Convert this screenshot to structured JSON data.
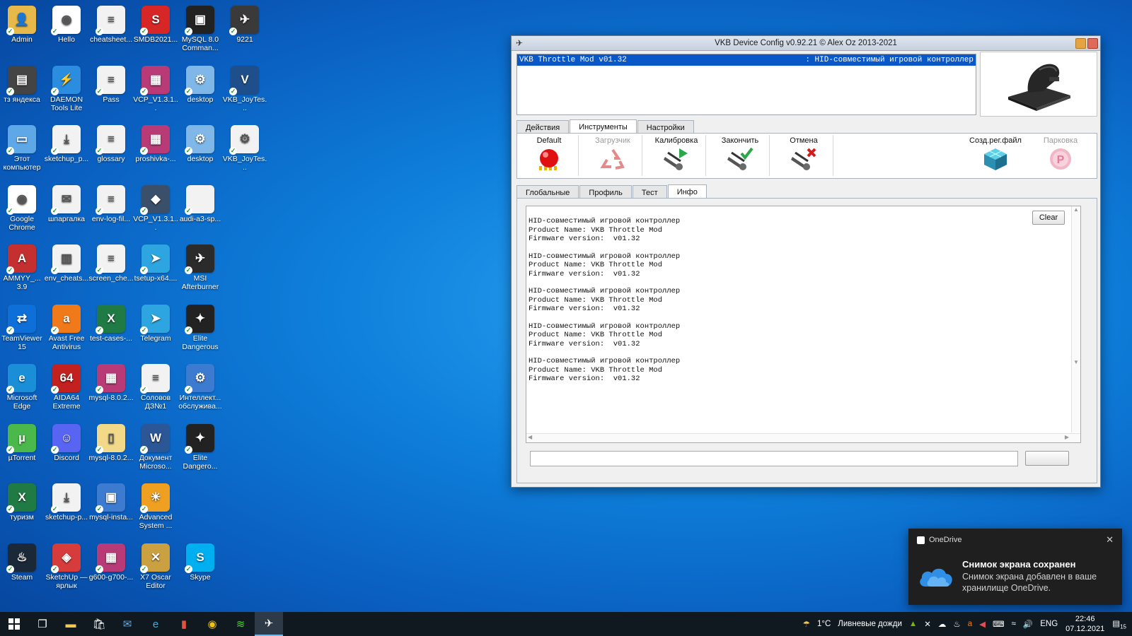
{
  "desktop": {
    "icons": [
      {
        "label": "Admin",
        "color": "#e7b84a",
        "glyph": "👤",
        "col": 0,
        "row": 0
      },
      {
        "label": "Hello",
        "color": "#ffffff",
        "glyph": "◉",
        "col": 1,
        "row": 0
      },
      {
        "label": "cheatsheet...",
        "color": "#f2f2f2",
        "glyph": "≡",
        "col": 2,
        "row": 0
      },
      {
        "label": "SMDB2021...",
        "color": "#d72626",
        "glyph": "S",
        "col": 3,
        "row": 0
      },
      {
        "label": "MySQL 8.0 Comman...",
        "color": "#222",
        "glyph": "▣",
        "col": 4,
        "row": 0
      },
      {
        "label": "9221",
        "color": "#3a3a3a",
        "glyph": "✈",
        "col": 5,
        "row": 0
      },
      {
        "label": "тз яндекса",
        "color": "#444",
        "glyph": "▤",
        "col": 0,
        "row": 1
      },
      {
        "label": "DAEMON Tools Lite",
        "color": "#2a8de0",
        "glyph": "⚡",
        "col": 1,
        "row": 1
      },
      {
        "label": "Pass",
        "color": "#f2f2f2",
        "glyph": "≡",
        "col": 2,
        "row": 1
      },
      {
        "label": "VCP_V1.3.1...",
        "color": "#b83b77",
        "glyph": "▦",
        "col": 3,
        "row": 1
      },
      {
        "label": "desktop",
        "color": "#7fb8e8",
        "glyph": "⚙",
        "col": 4,
        "row": 1
      },
      {
        "label": "VKB_JoyTes...",
        "color": "#1f4f8a",
        "glyph": "V",
        "col": 5,
        "row": 1
      },
      {
        "label": "Этот компьютер",
        "color": "#5fa8e8",
        "glyph": "▭",
        "col": 0,
        "row": 2
      },
      {
        "label": "sketchup_p...",
        "color": "#f2f2f2",
        "glyph": "⤓",
        "col": 1,
        "row": 2
      },
      {
        "label": "glossary",
        "color": "#f2f2f2",
        "glyph": "≡",
        "col": 2,
        "row": 2
      },
      {
        "label": "proshivka-...",
        "color": "#b83b77",
        "glyph": "▦",
        "col": 3,
        "row": 2
      },
      {
        "label": "desktop",
        "color": "#7fb8e8",
        "glyph": "⚙",
        "col": 4,
        "row": 2
      },
      {
        "label": "VKB_JoyTes...",
        "color": "#f2f2f2",
        "glyph": "⚙",
        "col": 5,
        "row": 2
      },
      {
        "label": "Google Chrome",
        "color": "#ffffff",
        "glyph": "◉",
        "col": 0,
        "row": 3
      },
      {
        "label": "шпаргалка",
        "color": "#f2f2f2",
        "glyph": "✉",
        "col": 1,
        "row": 3
      },
      {
        "label": "env-log-fil...",
        "color": "#f2f2f2",
        "glyph": "≡",
        "col": 2,
        "row": 3
      },
      {
        "label": "VCP_V1.3.1...",
        "color": "#3a4f6a",
        "glyph": "◆",
        "col": 3,
        "row": 3
      },
      {
        "label": "audi-a3-sp...",
        "color": "#f2f2f2",
        "glyph": "",
        "col": 4,
        "row": 3
      },
      {
        "label": "AMMYY_... 3.9",
        "color": "#c43030",
        "glyph": "A",
        "col": 0,
        "row": 4
      },
      {
        "label": "env_cheats...",
        "color": "#f2f2f2",
        "glyph": "▥",
        "col": 1,
        "row": 4
      },
      {
        "label": "screen_che...",
        "color": "#f2f2f2",
        "glyph": "≡",
        "col": 2,
        "row": 4
      },
      {
        "label": "tsetup-x64....",
        "color": "#2ca5e0",
        "glyph": "➤",
        "col": 3,
        "row": 4
      },
      {
        "label": "MSI Afterburner",
        "color": "#2b2b2b",
        "glyph": "✈",
        "col": 4,
        "row": 4
      },
      {
        "label": "TeamViewer 15",
        "color": "#0e6fd8",
        "glyph": "⇄",
        "col": 0,
        "row": 5
      },
      {
        "label": "Avast Free Antivirus",
        "color": "#f07a1a",
        "glyph": "a",
        "col": 1,
        "row": 5
      },
      {
        "label": "test-cases-...",
        "color": "#1f7a43",
        "glyph": "X",
        "col": 2,
        "row": 5
      },
      {
        "label": "Telegram",
        "color": "#2ca5e0",
        "glyph": "➤",
        "col": 3,
        "row": 5
      },
      {
        "label": "Elite Dangerous",
        "color": "#222",
        "glyph": "✦",
        "col": 4,
        "row": 5
      },
      {
        "label": "Microsoft Edge",
        "color": "#1a8fd8",
        "glyph": "e",
        "col": 0,
        "row": 6
      },
      {
        "label": "AIDA64 Extreme",
        "color": "#c32020",
        "glyph": "64",
        "col": 1,
        "row": 6
      },
      {
        "label": "mysql-8.0.2...",
        "color": "#b83b77",
        "glyph": "▦",
        "col": 2,
        "row": 6
      },
      {
        "label": "Соловов ДЗ№1",
        "color": "#f2f2f2",
        "glyph": "≡",
        "col": 3,
        "row": 6
      },
      {
        "label": "Интеллект... обслужива...",
        "color": "#3c7bd0",
        "glyph": "⚙",
        "col": 4,
        "row": 6
      },
      {
        "label": "µTorrent",
        "color": "#4ab84a",
        "glyph": "µ",
        "col": 0,
        "row": 7
      },
      {
        "label": "Discord",
        "color": "#5865f2",
        "glyph": "☺",
        "col": 1,
        "row": 7
      },
      {
        "label": "mysql-8.0.2...",
        "color": "#f2d98a",
        "glyph": "▯",
        "col": 2,
        "row": 7
      },
      {
        "label": "Документ Microso...",
        "color": "#2b5797",
        "glyph": "W",
        "col": 3,
        "row": 7
      },
      {
        "label": "Elite Dangero...",
        "color": "#222",
        "glyph": "✦",
        "col": 4,
        "row": 7
      },
      {
        "label": "туризм",
        "color": "#1f7a43",
        "glyph": "X",
        "col": 0,
        "row": 8
      },
      {
        "label": "sketchup-p...",
        "color": "#f2f2f2",
        "glyph": "⤓",
        "col": 1,
        "row": 8
      },
      {
        "label": "mysql-insta...",
        "color": "#3c7bd0",
        "glyph": "▣",
        "col": 2,
        "row": 8
      },
      {
        "label": "Advanced System ...",
        "color": "#f0a020",
        "glyph": "☀",
        "col": 3,
        "row": 8
      },
      {
        "label": "Steam",
        "color": "#1b2838",
        "glyph": "♨",
        "col": 0,
        "row": 9
      },
      {
        "label": "SketchUp — ярлык",
        "color": "#d63c3c",
        "glyph": "◈",
        "col": 1,
        "row": 9
      },
      {
        "label": "g600-g700-...",
        "color": "#b83b77",
        "glyph": "▦",
        "col": 2,
        "row": 9
      },
      {
        "label": "X7 Oscar Editor",
        "color": "#caa040",
        "glyph": "✕",
        "col": 3,
        "row": 9
      },
      {
        "label": "Skype",
        "color": "#00aff0",
        "glyph": "S",
        "col": 4,
        "row": 9
      }
    ]
  },
  "window": {
    "title": "VKB Device Config v0.92.21  © Alex Oz 2013-2021",
    "device_name": "VKB Throttle Mod v01.32",
    "device_type": ": HID-совместимый игровой контроллер",
    "tabs": [
      {
        "label": "Действия",
        "active": false
      },
      {
        "label": "Инструменты",
        "active": true
      },
      {
        "label": "Настройки",
        "active": false
      }
    ],
    "tools": [
      {
        "label": "Default",
        "name": "default-button",
        "icon": "red-ball-icon",
        "disabled": false
      },
      {
        "label": "Загрузчик",
        "name": "bootloader-button",
        "icon": "recycle-icon",
        "disabled": true
      },
      {
        "label": "Калибровка",
        "name": "calibration-button",
        "icon": "calibrate-start-icon",
        "disabled": false
      },
      {
        "label": "Закончить",
        "name": "finish-button",
        "icon": "calibrate-done-icon",
        "disabled": false
      },
      {
        "label": "Отмена",
        "name": "cancel-button",
        "icon": "calibrate-cancel-icon",
        "disabled": false
      }
    ],
    "tools_right": [
      {
        "label": "Созд.рег.файл",
        "name": "create-reg-file-button",
        "icon": "registry-cube-icon",
        "disabled": false
      },
      {
        "label": "Парковка",
        "name": "parking-button",
        "icon": "parking-icon",
        "disabled": true
      }
    ],
    "subtabs": [
      {
        "label": "Глобальные",
        "active": false
      },
      {
        "label": "Профиль",
        "active": false
      },
      {
        "label": "Тест",
        "active": false
      },
      {
        "label": "Инфо",
        "active": true
      }
    ],
    "clear_label": "Clear",
    "log_blocks": [
      [
        "HID-совместимый игровой контроллер",
        "Product Name: VKB Throttle Mod",
        "Firmware version:  v01.32"
      ],
      [
        "HID-совместимый игровой контроллер",
        "Product Name: VKB Throttle Mod",
        "Firmware version:  v01.32"
      ],
      [
        "HID-совместимый игровой контроллер",
        "Product Name: VKB Throttle Mod",
        "Firmware version:  v01.32"
      ],
      [
        "HID-совместимый игровой контроллер",
        "Product Name: VKB Throttle Mod",
        "Firmware version:  v01.32"
      ],
      [
        "HID-совместимый игровой контроллер",
        "Product Name: VKB Throttle Mod",
        "Firmware version:  v01.32"
      ]
    ]
  },
  "notification": {
    "app": "OneDrive",
    "title": "Снимок экрана сохранен",
    "body": "Снимок экрана добавлен в ваше хранилище OneDrive."
  },
  "taskbar": {
    "weather_temp": "1°C",
    "weather_text": "Ливневые дожди",
    "lang": "ENG",
    "time": "22:46",
    "date": "07.12.2021",
    "notif_count": "15"
  }
}
